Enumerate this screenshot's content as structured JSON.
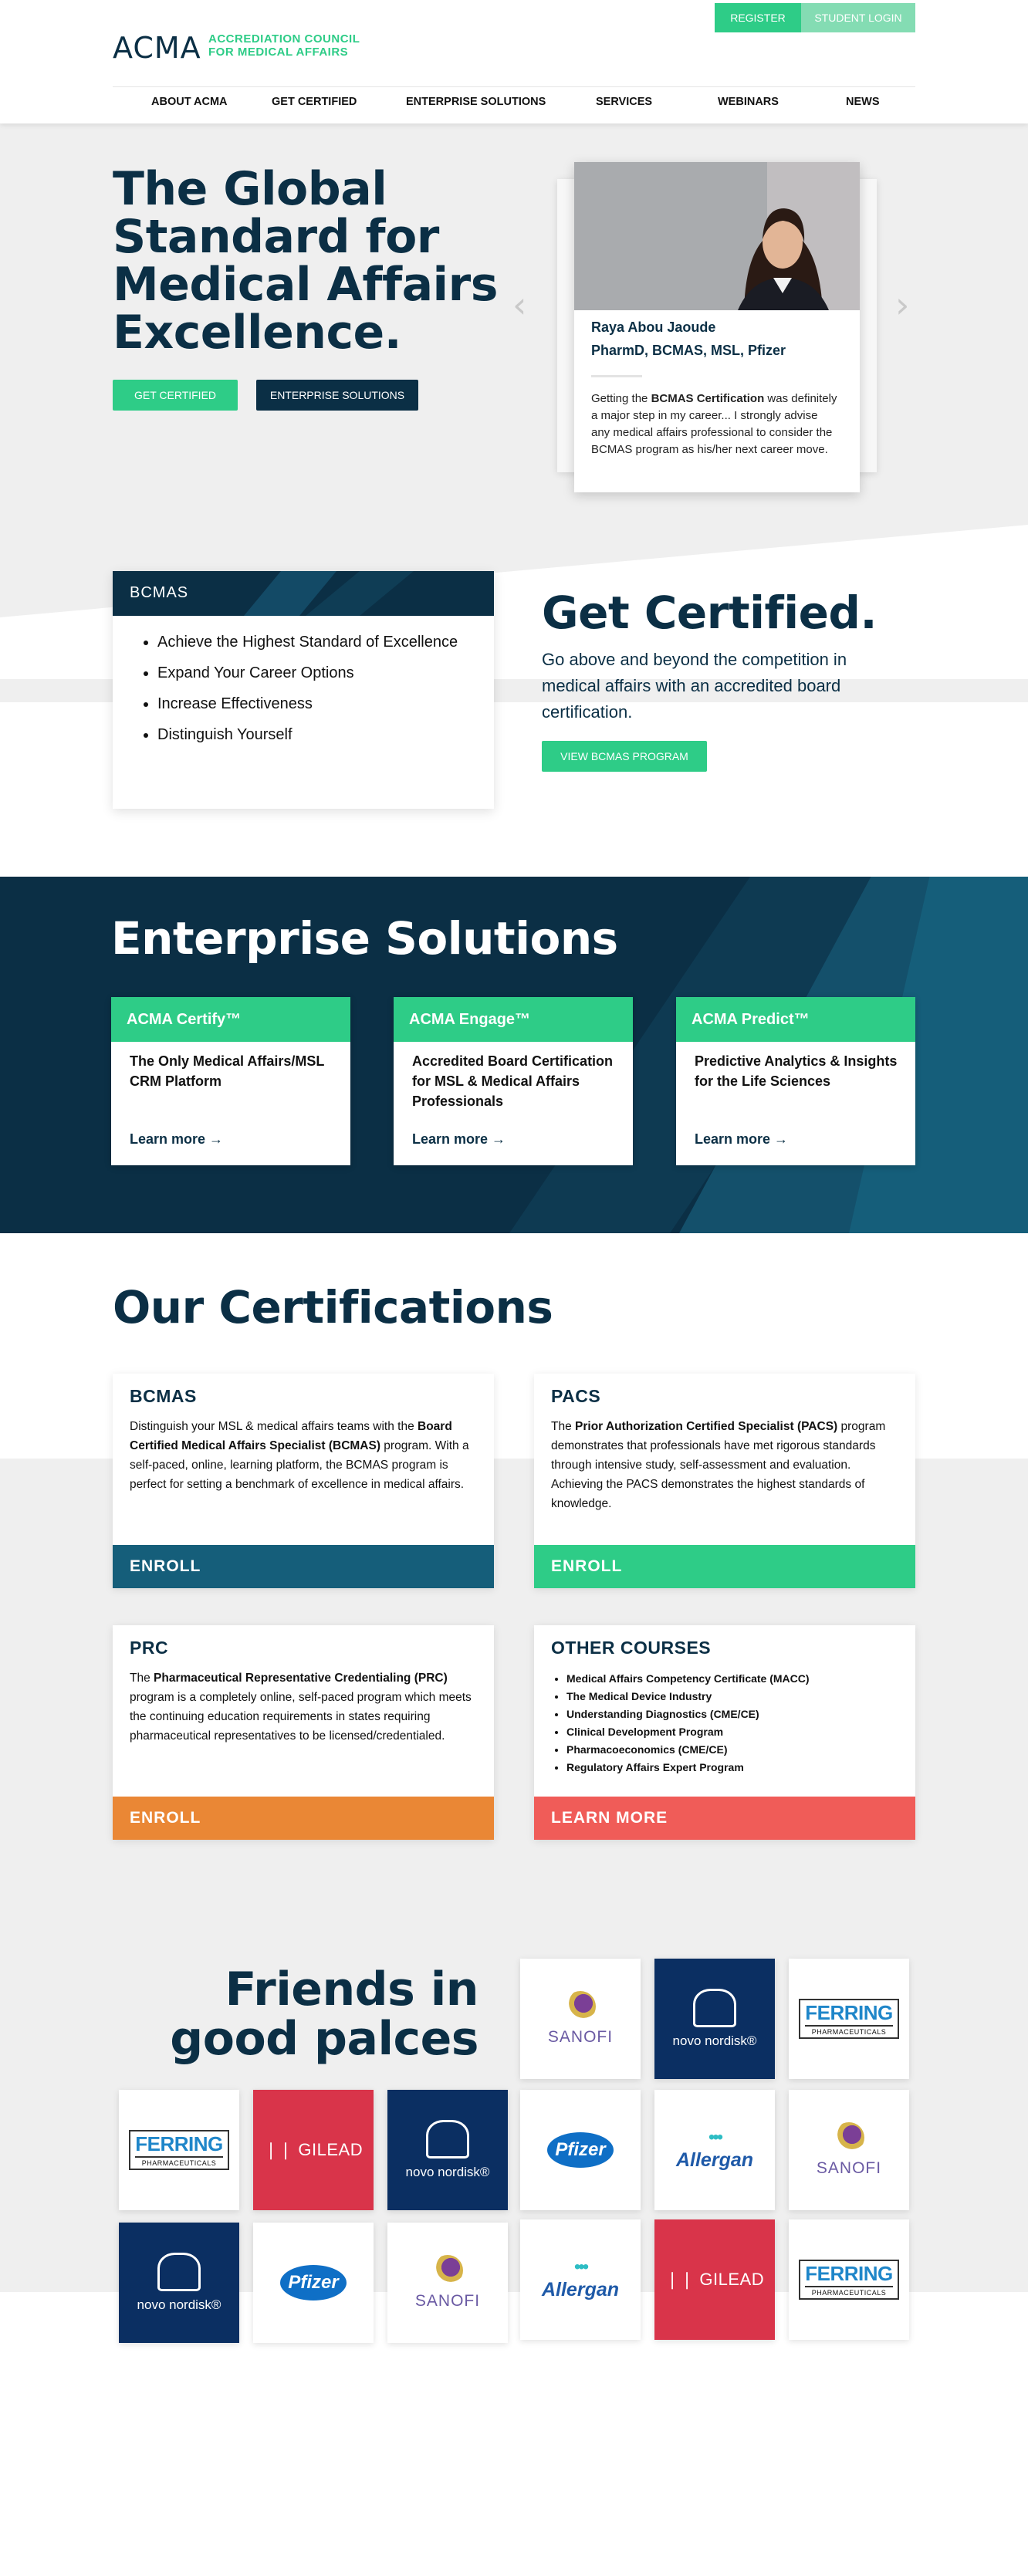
{
  "header": {
    "logo_acma": "ACMA",
    "logo_sub_line1": "ACCREDIATION COUNCIL",
    "logo_sub_line2": "FOR MEDICAL AFFAIRS",
    "register": "REGISTER",
    "student_login": "STUDENT LOGIN",
    "nav": [
      "ABOUT ACMA",
      "GET CERTIFIED",
      "ENTERPRISE SOLUTIONS",
      "SERVICES",
      "WEBINARS",
      "NEWS"
    ]
  },
  "hero": {
    "title": "The Global Standard for Medical Affairs Excellence.",
    "btn_certified": "GET CERTIFIED",
    "btn_enterprise": "ENTERPRISE SOLUTIONS",
    "testimonial": {
      "name": "Raya Abou Jaoude",
      "credentials": "PharmD, BCMAS, MSL, Pfizer",
      "quote_pre": "Getting the ",
      "quote_bold": "BCMAS Certification",
      "quote_post": " was definitely a major step in my career... I strongly advise any medical affairs professional to consider the BCMAS program as his/her next career move."
    },
    "prev_icon": "chevron-left-icon",
    "next_icon": "chevron-right-icon"
  },
  "bcmas_box": {
    "title": "BCMAS",
    "items": [
      "Achieve the Highest Standard of Excellence",
      "Expand Your Career Options",
      "Increase Effectiveness",
      "Distinguish Yourself"
    ]
  },
  "get_certified": {
    "title": "Get Certified.",
    "text": "Go above and beyond the competition in medical affairs with an accredited board certification.",
    "button": "VIEW BCMAS PROGRAM"
  },
  "enterprise": {
    "title": "Enterprise Solutions",
    "cards": [
      {
        "title": "ACMA Certify™",
        "desc": "The Only Medical Affairs/MSL CRM Platform",
        "link": "Learn more →"
      },
      {
        "title": "ACMA Engage™",
        "desc": "Accredited Board Certification for MSL & Medical Affairs Professionals",
        "link": "Learn more →"
      },
      {
        "title": "ACMA Predict™",
        "desc": "Predictive Analytics & Insights for the Life Sciences",
        "link": "Learn more →"
      }
    ]
  },
  "certifications": {
    "title": "Our Certifications",
    "bcmas": {
      "title": "BCMAS",
      "pre": "Distinguish your MSL & medical affairs teams with the ",
      "bold": "Board Certified Medical Affairs Specialist (BCMAS)",
      "post": " program. With a self-paced, online, learning platform, the BCMAS program is perfect for setting a benchmark of excellence in medical affairs.",
      "button": "ENROLL"
    },
    "pacs": {
      "title": "PACS",
      "pre": "The ",
      "bold": "Prior Authorization Certified Specialist (PACS)",
      "post": " program demonstrates that professionals have met rigorous standards through intensive study, self-assessment and evaluation. Achieving the PACS demonstrates the highest standards of knowledge.",
      "button": "ENROLL"
    },
    "prc": {
      "title": "PRC",
      "pre": "The ",
      "bold": "Pharmaceutical Representative Credentialing (PRC)",
      "post": " program is a completely online, self-paced program which meets the continuing education requirements in states requiring pharmaceutical representatives to be licensed/credentialed.",
      "button": "ENROLL"
    },
    "other": {
      "title": "OTHER COURSES",
      "items": [
        "Medical Affairs Competency Certificate (MACC)",
        "The Medical Device Industry",
        "Understanding Diagnostics (CME/CE)",
        "Clinical Development Program",
        "Pharmacoeconomics (CME/CE)",
        "Regulatory Affairs Expert Program"
      ],
      "button": "LEARN MORE"
    }
  },
  "partners": {
    "title_line1": "Friends in",
    "title_line2": "good palces",
    "sanofi": "SANOFI",
    "novo": "novo nordisk®",
    "ferring": "FERRING",
    "ferring_sub": "PHARMACEUTICALS",
    "gilead": "GILEAD",
    "pfizer": "Pfizer",
    "allergan": "Allergan"
  },
  "colors": {
    "navy": "#0b2f45",
    "green": "#2ecc87",
    "teal": "#155e7a",
    "orange": "#ea8735",
    "coral": "#f05c58"
  }
}
